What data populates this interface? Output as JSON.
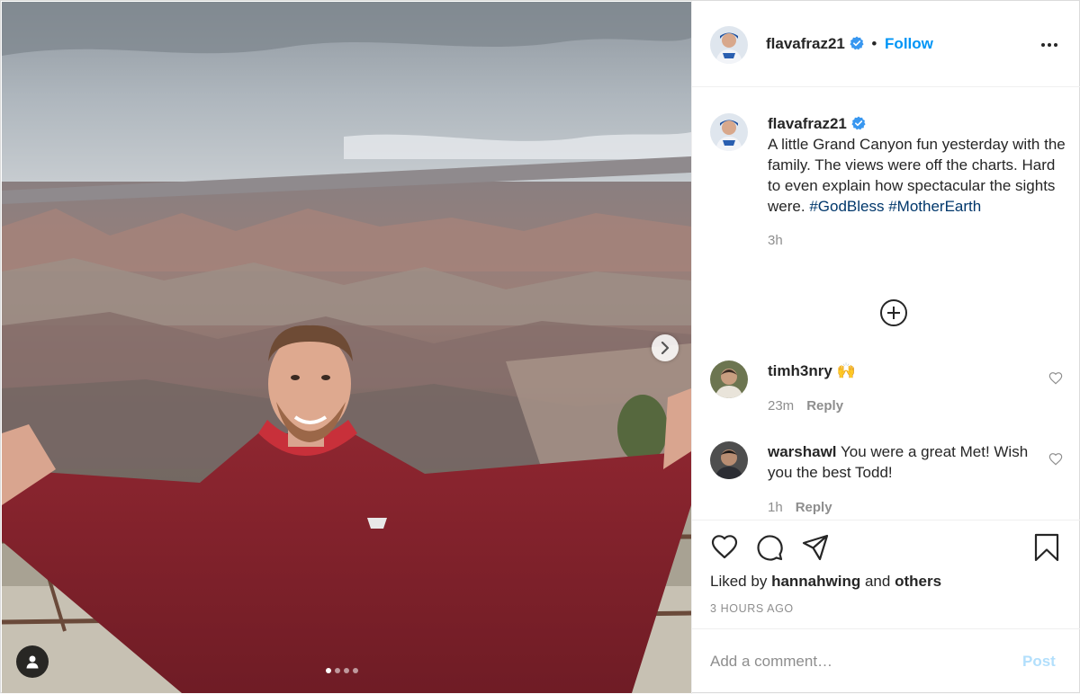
{
  "post": {
    "username": "flavafraz21",
    "follow_label": "Follow",
    "separator": "•",
    "caption_text": "A little Grand Canyon fun yesterday with the family. The views were off the charts. Hard to even explain how spectacular the sights were.",
    "hashtags": [
      "#GodBless",
      "#MotherEarth"
    ],
    "caption_time": "3h",
    "photo_index": 1,
    "photo_count": 4
  },
  "comments": [
    {
      "username": "timh3nry",
      "text": "🙌",
      "time": "23m",
      "reply_label": "Reply"
    },
    {
      "username": "warshawl",
      "text": "You were a great Met! Wish you the best Todd!",
      "time": "1h",
      "reply_label": "Reply"
    }
  ],
  "likes": {
    "prefix": "Liked by",
    "user": "hannahwing",
    "connector": "and",
    "others": "others"
  },
  "timestamp": "3 HOURS AGO",
  "add_comment": {
    "placeholder": "Add a comment…",
    "post_label": "Post"
  },
  "icons": {
    "verified": "verified-badge-icon",
    "more": "more-options-icon",
    "load_more": "plus-circle-icon",
    "like": "heart-icon",
    "comment": "comment-bubble-icon",
    "share": "paper-plane-icon",
    "save": "bookmark-icon",
    "next": "chevron-right-icon",
    "user_tag": "user-tag-icon"
  },
  "colors": {
    "link_blue": "#0095f6",
    "hashtag": "#00376b",
    "secondary_text": "#8e8e8e",
    "verified": "#3897f0"
  }
}
